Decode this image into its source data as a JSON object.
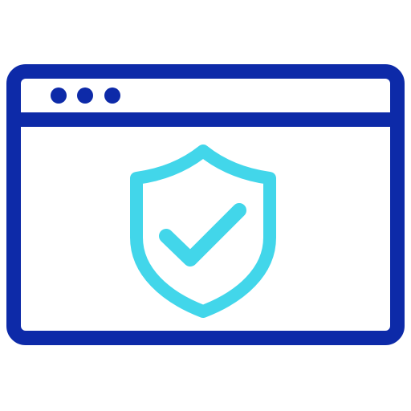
{
  "icon": {
    "name": "secure-browser-window-icon",
    "window_frame_icon": "browser-window-icon",
    "window_control_icons": [
      "window-dot-icon",
      "window-dot-icon",
      "window-dot-icon"
    ],
    "badge_icon": "shield-check-icon"
  },
  "colors": {
    "background": "#ffffff",
    "window_stroke": "#0d2aa8",
    "shield_stroke": "#42d6ea"
  }
}
